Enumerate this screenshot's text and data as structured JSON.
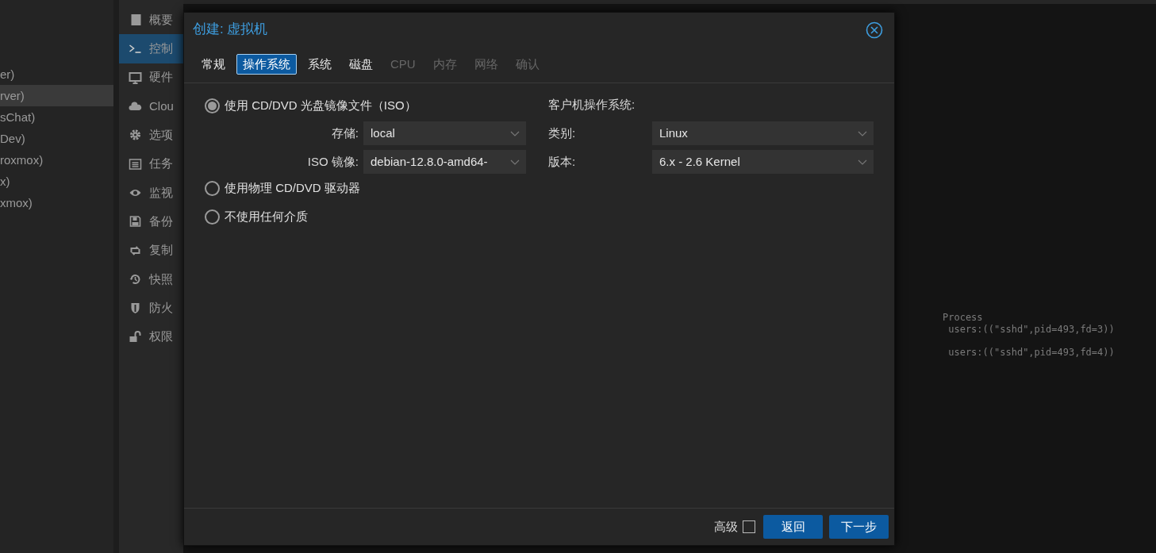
{
  "tree": {
    "items": [
      {
        "label": "er)",
        "selected": false
      },
      {
        "label": "rver)",
        "selected": true
      },
      {
        "label": "sChat)",
        "selected": false
      },
      {
        "label": "Dev)",
        "selected": false
      },
      {
        "label": "roxmox)",
        "selected": false
      },
      {
        "label": "x)",
        "selected": false
      },
      {
        "label": "xmox)",
        "selected": false
      }
    ]
  },
  "nav": {
    "items": [
      {
        "label": "概要",
        "selected": false
      },
      {
        "label": "控制",
        "selected": true
      },
      {
        "label": "硬件",
        "selected": false
      },
      {
        "label": "Clou",
        "selected": false
      },
      {
        "label": "选项",
        "selected": false
      },
      {
        "label": "任务",
        "selected": false
      },
      {
        "label": "监视",
        "selected": false
      },
      {
        "label": "备份",
        "selected": false
      },
      {
        "label": "复制",
        "selected": false
      },
      {
        "label": "快照",
        "selected": false
      },
      {
        "label": "防火",
        "selected": false
      },
      {
        "label": "权限",
        "selected": false
      }
    ]
  },
  "console": {
    "lines": [
      "Process",
      " users:((\"sshd\",pid=493,fd=3))",
      " users:((\"sshd\",pid=493,fd=4))"
    ]
  },
  "dialog": {
    "title": "创建: 虚拟机",
    "tabs": [
      {
        "label": "常规",
        "selected": false,
        "disabled": false
      },
      {
        "label": "操作系统",
        "selected": true,
        "disabled": false
      },
      {
        "label": "系统",
        "selected": false,
        "disabled": false
      },
      {
        "label": "磁盘",
        "selected": false,
        "disabled": false
      },
      {
        "label": "CPU",
        "selected": false,
        "disabled": true
      },
      {
        "label": "内存",
        "selected": false,
        "disabled": true
      },
      {
        "label": "网络",
        "selected": false,
        "disabled": true
      },
      {
        "label": "确认",
        "selected": false,
        "disabled": true
      }
    ],
    "media_options": [
      {
        "label": "使用 CD/DVD 光盘镜像文件（ISO）",
        "selected": true,
        "fields": [
          {
            "label": "存储:",
            "value": "local"
          },
          {
            "label": "ISO 镜像:",
            "value": "debian-12.8.0-amd64-"
          }
        ]
      },
      {
        "label": "使用物理 CD/DVD 驱动器",
        "selected": false
      },
      {
        "label": "不使用任何介质",
        "selected": false
      }
    ],
    "guest_os": {
      "heading": "客户机操作系统:",
      "fields": [
        {
          "label": "类别:",
          "value": "Linux"
        },
        {
          "label": "版本:",
          "value": "6.x - 2.6 Kernel"
        }
      ]
    },
    "advanced": {
      "label": "高级",
      "checked": false
    },
    "buttons": [
      {
        "label": "返回"
      },
      {
        "label": "下一步"
      }
    ]
  }
}
